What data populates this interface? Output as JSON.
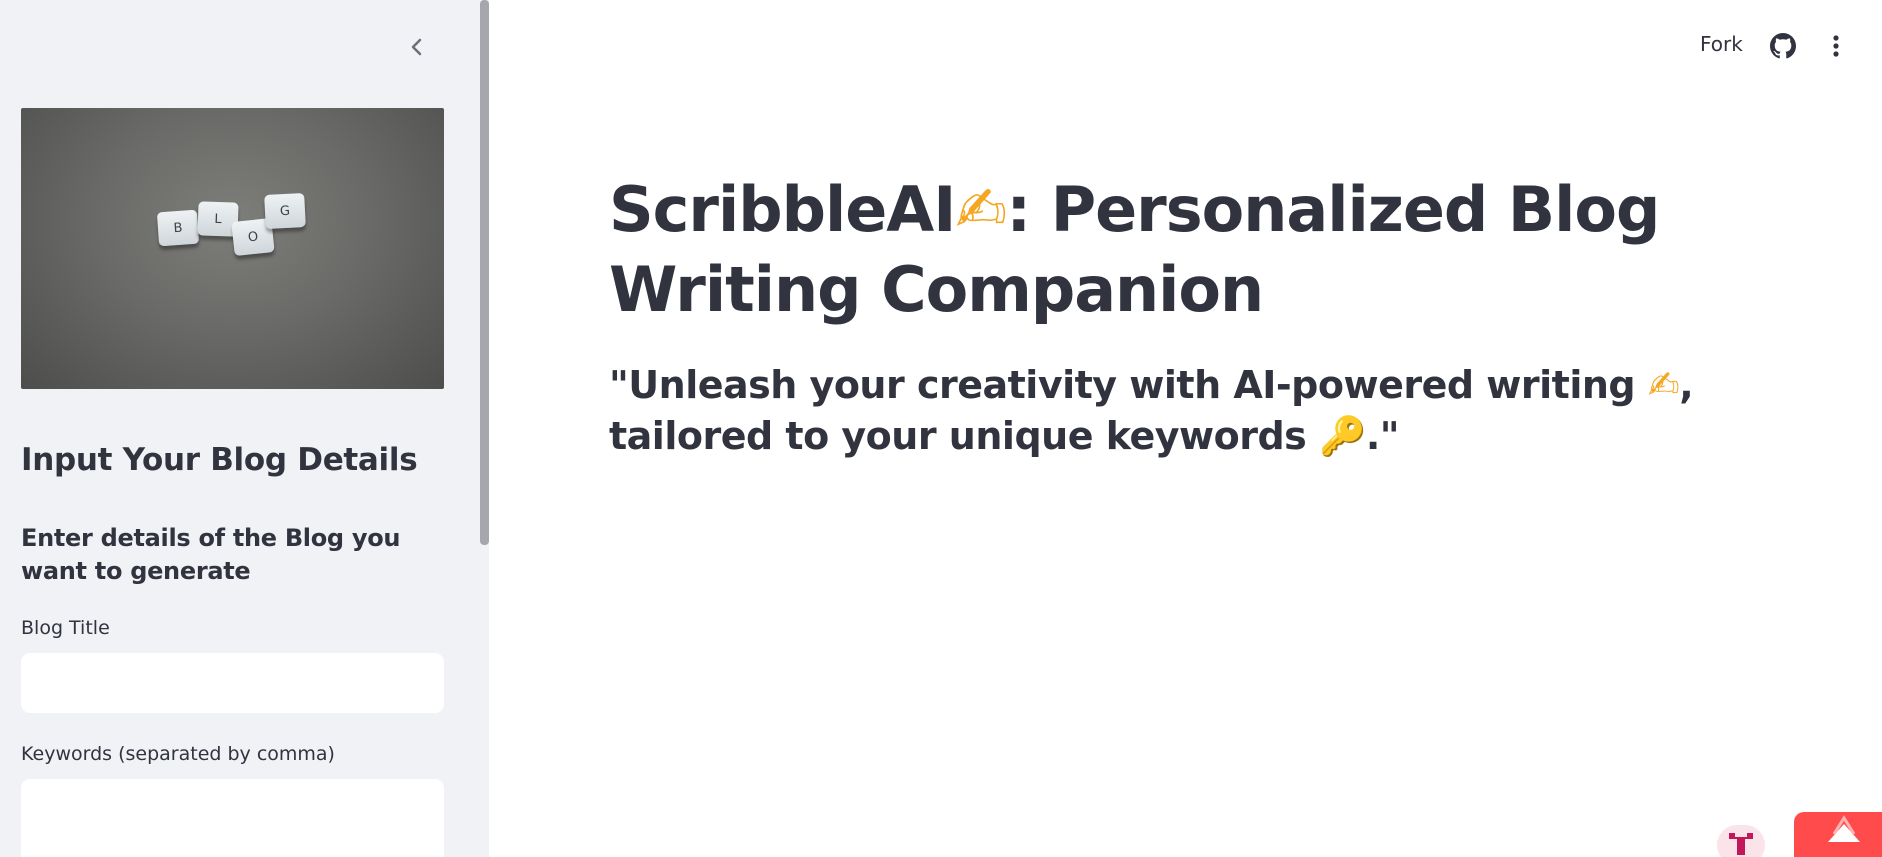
{
  "sidebar": {
    "collapse_icon": "chevron-left-icon",
    "image_tiles": [
      "B",
      "L",
      "O",
      "G"
    ],
    "heading": "Input Your Blog Details",
    "subheading": "Enter details of the Blog you want to generate",
    "fields": [
      {
        "label": "Blog Title",
        "value": "",
        "placeholder": ""
      },
      {
        "label": "Keywords (separated by comma)",
        "value": "",
        "placeholder": ""
      }
    ]
  },
  "toolbar": {
    "fork_label": "Fork",
    "github_icon": "github-icon",
    "menu_icon": "more-vertical-icon"
  },
  "main": {
    "title_part1": "ScribbleAI",
    "title_emoji": "✍",
    "title_part2": ": Personalized Blog Writing Companion",
    "subtitle_part1": "\"Unleash your creativity with AI-powered writing",
    "subtitle_emoji1": "✍",
    "subtitle_part2": ", tailored to your unique keywords",
    "subtitle_emoji2": "🔑",
    "subtitle_part3": ".\""
  },
  "colors": {
    "sidebar_bg": "#f0f2f6",
    "text": "#31333f",
    "accent": "#ff4b4b"
  }
}
